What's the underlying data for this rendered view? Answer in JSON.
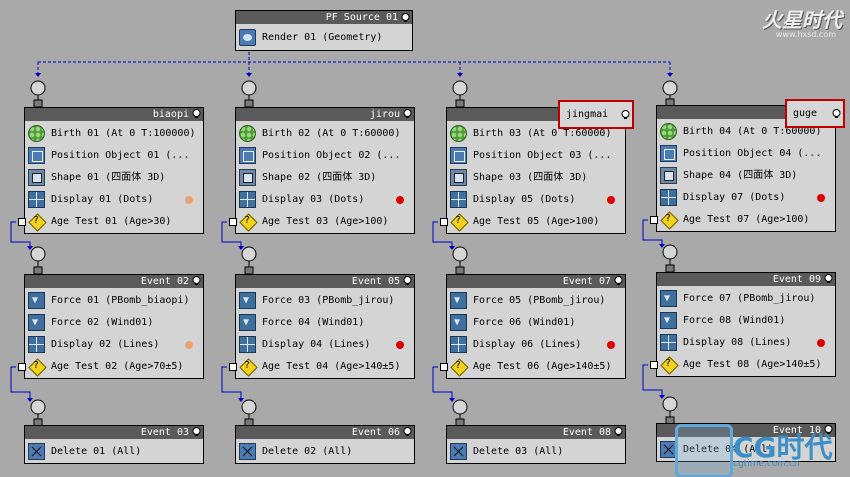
{
  "colors": {
    "canvas_bg": "#a9a9a9",
    "node_bg": "#d4d4d4",
    "title_bg": "#5a5a5a",
    "dot_red": "#dd0000",
    "dot_orange": "#e8a27a",
    "highlight": "#c00000",
    "wire_blue": "#0000c8"
  },
  "watermark": {
    "top_logo": "火星时代",
    "top_url": "www.hxsd.com",
    "bottom_brand": "CG时代",
    "bottom_url": "cgtime.com.cn"
  },
  "source": {
    "title": "PF Source 01",
    "render": "Render 01 (Geometry)"
  },
  "columns": [
    {
      "event": {
        "title": "biaopi",
        "highlighted": false,
        "ops": [
          {
            "icon": "birth",
            "label": "Birth 01 (At 0 T:100000)"
          },
          {
            "icon": "position",
            "label": "Position Object 01 (..."
          },
          {
            "icon": "shape",
            "label": "Shape 01 (四面体 3D)"
          },
          {
            "icon": "display",
            "label": "Display 01 (Dots)",
            "dot": "orange"
          },
          {
            "icon": "age-test",
            "label": "Age Test 01 (Age>30)"
          }
        ]
      },
      "event2": {
        "title": "Event 02",
        "ops": [
          {
            "icon": "force",
            "label": "Force 01 (PBomb_biaopi)"
          },
          {
            "icon": "force",
            "label": "Force 02 (Wind01)"
          },
          {
            "icon": "display",
            "label": "Display 02 (Lines)",
            "dot": "orange"
          },
          {
            "icon": "age-test",
            "label": "Age Test 02 (Age>70±5)"
          }
        ]
      },
      "event3": {
        "title": "Event 03",
        "ops": [
          {
            "icon": "delete",
            "label": "Delete 01 (All)"
          }
        ]
      }
    },
    {
      "event": {
        "title": "jirou",
        "highlighted": false,
        "ops": [
          {
            "icon": "birth",
            "label": "Birth 02 (At 0 T:60000)"
          },
          {
            "icon": "position",
            "label": "Position Object 02 (..."
          },
          {
            "icon": "shape",
            "label": "Shape 02 (四面体 3D)"
          },
          {
            "icon": "display",
            "label": "Display 03 (Dots)",
            "dot": "red"
          },
          {
            "icon": "age-test",
            "label": "Age Test 03 (Age>100)"
          }
        ]
      },
      "event2": {
        "title": "Event 05",
        "ops": [
          {
            "icon": "force",
            "label": "Force 03 (PBomb_jirou)"
          },
          {
            "icon": "force",
            "label": "Force 04 (Wind01)"
          },
          {
            "icon": "display",
            "label": "Display 04 (Lines)",
            "dot": "red"
          },
          {
            "icon": "age-test",
            "label": "Age Test 04 (Age>140±5)"
          }
        ]
      },
      "event3": {
        "title": "Event 06",
        "ops": [
          {
            "icon": "delete",
            "label": "Delete 02 (All)"
          }
        ]
      }
    },
    {
      "event": {
        "title": "jingmai",
        "highlighted": true,
        "ops": [
          {
            "icon": "birth",
            "label": "Birth 03 (At 0 T:60000)"
          },
          {
            "icon": "position",
            "label": "Position Object 03 (..."
          },
          {
            "icon": "shape",
            "label": "Shape 03 (四面体 3D)"
          },
          {
            "icon": "display",
            "label": "Display 05 (Dots)",
            "dot": "red"
          },
          {
            "icon": "age-test",
            "label": "Age Test 05 (Age>100)"
          }
        ]
      },
      "event2": {
        "title": "Event 07",
        "ops": [
          {
            "icon": "force",
            "label": "Force 05 (PBomb_jirou)"
          },
          {
            "icon": "force",
            "label": "Force 06 (Wind01)"
          },
          {
            "icon": "display",
            "label": "Display 06 (Lines)",
            "dot": "red"
          },
          {
            "icon": "age-test",
            "label": "Age Test 06 (Age>140±5)"
          }
        ]
      },
      "event3": {
        "title": "Event 08",
        "ops": [
          {
            "icon": "delete",
            "label": "Delete 03 (All)"
          }
        ]
      }
    },
    {
      "event": {
        "title": "guge",
        "highlighted": true,
        "ops": [
          {
            "icon": "birth",
            "label": "Birth 04 (At 0 T:60000)"
          },
          {
            "icon": "position",
            "label": "Position Object 04 (..."
          },
          {
            "icon": "shape",
            "label": "Shape 04 (四面体 3D)"
          },
          {
            "icon": "display",
            "label": "Display 07 (Dots)",
            "dot": "red"
          },
          {
            "icon": "age-test",
            "label": "Age Test 07 (Age>100)"
          }
        ]
      },
      "event2": {
        "title": "Event 09",
        "ops": [
          {
            "icon": "force",
            "label": "Force 07 (PBomb_jirou)"
          },
          {
            "icon": "force",
            "label": "Force 08 (Wind01)"
          },
          {
            "icon": "display",
            "label": "Display 08 (Lines)",
            "dot": "red"
          },
          {
            "icon": "age-test",
            "label": "Age Test 08 (Age>140±5)"
          }
        ]
      },
      "event3": {
        "title": "Event 10",
        "ops": [
          {
            "icon": "delete",
            "label": "Delete 04 (All)"
          }
        ]
      }
    }
  ]
}
